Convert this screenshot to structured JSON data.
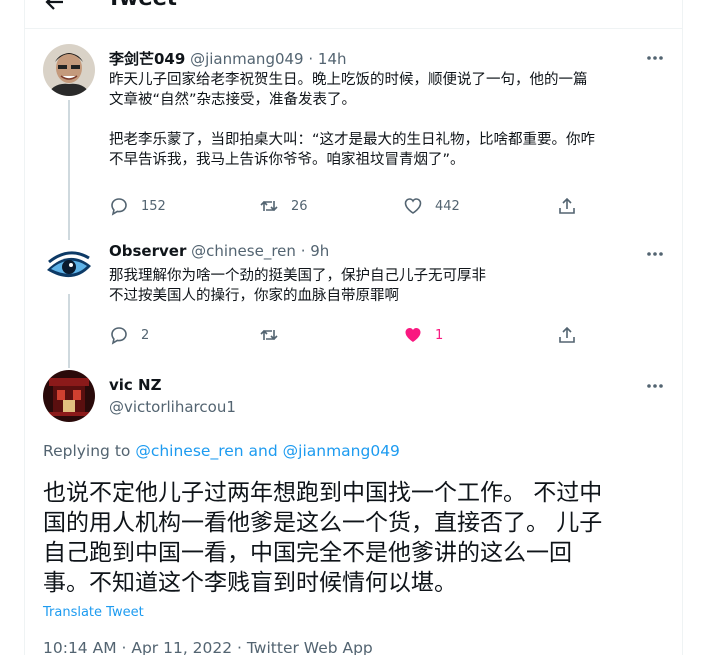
{
  "header": {
    "title": "Tweet"
  },
  "tweets": [
    {
      "name": "李剑芒049",
      "handle": "@jianmang049",
      "time": "· 14h",
      "text": [
        "昨天儿子回家给老李祝贺生日。晚上吃饭的时候，顺便说了一句，他的一篇",
        "文章被“自然”杂志接受，准备发表了。",
        "",
        "把老李乐蒙了，当即拍桌大叫：“这才是最大的生日礼物，比啥都重要。你咋",
        "不早告诉我，我马上告诉你爷爷。咱家祖坟冒青烟了”。"
      ],
      "replies": "152",
      "retweets": "26",
      "likes": "442"
    },
    {
      "name": "Observer",
      "handle": "@chinese_ren",
      "time": "· 9h",
      "text": [
        "那我理解你为啥一个劲的挺美国了，保护自己儿子无可厚非",
        "不过按美国人的操行，你家的血脉自带原罪啊"
      ],
      "replies": "2",
      "retweets": "",
      "likes": "1"
    }
  ],
  "main": {
    "name": "vic NZ",
    "handle": "@victorliharcou1",
    "replying_prefix": "Replying to",
    "replying_user1": "@chinese_ren",
    "replying_and": "and",
    "replying_user2": "@jianmang049",
    "text": [
      "也说不定他儿子过两年想跑到中国找一个工作。 不过中",
      "国的用人机构一看他爹是这么一个货，直接否了。 儿子",
      "自己跑到中国一看，中国完全不是他爹讲的这么一回",
      "事。不知道这个李贱盲到时候情何以堪。"
    ],
    "translate": "Translate Tweet",
    "timestamp": "10:14 AM · Apr 11, 2022 · Twitter Web App"
  },
  "colors": {
    "accent": "#1d9bf0",
    "like_active": "#f91880",
    "muted": "#536471"
  }
}
